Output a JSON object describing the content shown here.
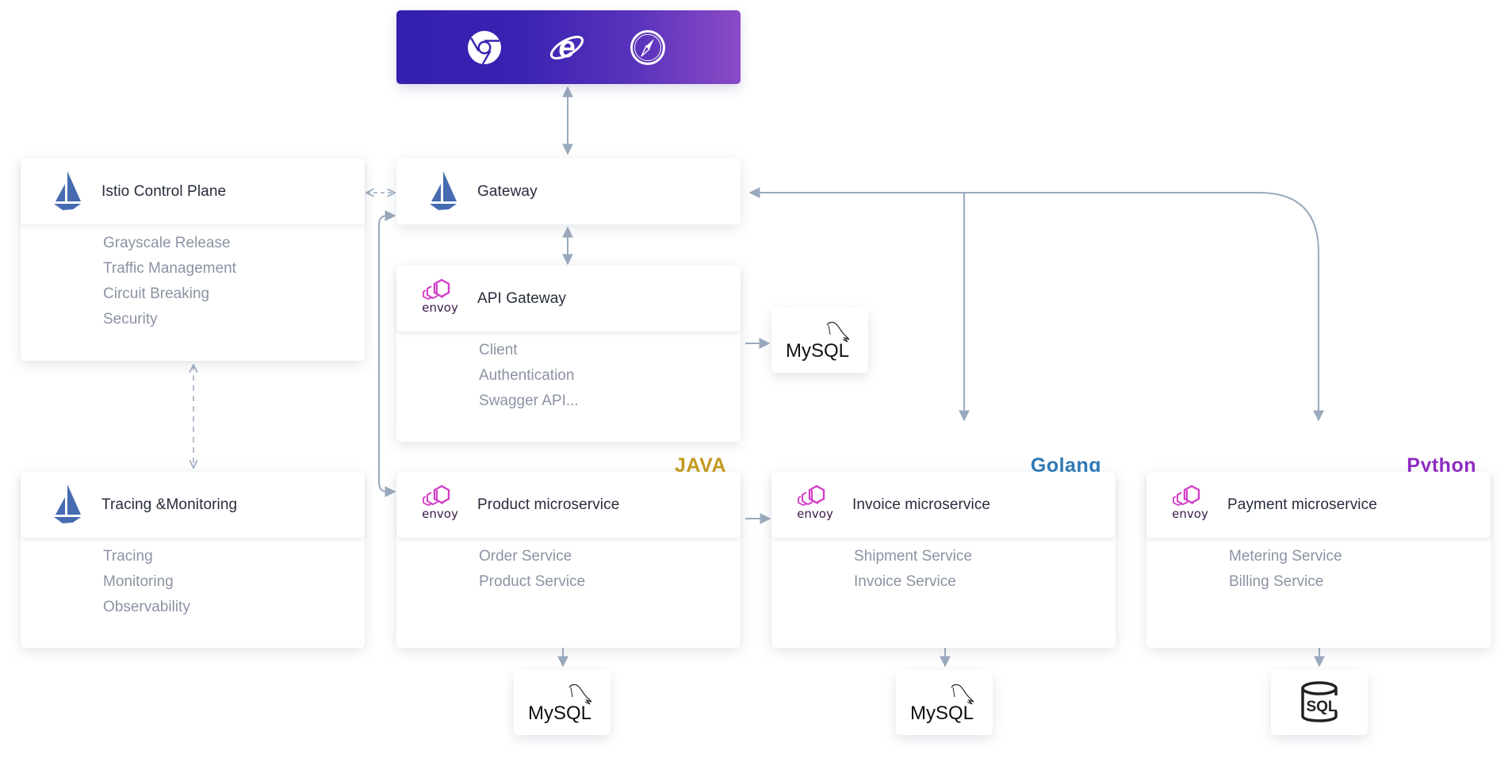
{
  "browsers": [
    {
      "name": "Chrome",
      "icon": "chrome-icon"
    },
    {
      "name": "Internet Explorer",
      "icon": "internet-explorer-icon"
    },
    {
      "name": "Safari",
      "icon": "safari-icon"
    }
  ],
  "cards": {
    "istio_control_plane": {
      "title": "Istio Control Plane",
      "icon": "istio-icon",
      "items": [
        "Grayscale Release",
        "Traffic Management",
        "Circuit Breaking",
        "Security"
      ]
    },
    "gateway": {
      "title": "Gateway",
      "icon": "istio-icon"
    },
    "api_gateway": {
      "title": "API Gateway",
      "icon": "envoy-icon",
      "items": [
        "Client",
        "Authentication",
        "Swagger API..."
      ]
    },
    "tracing_monitoring": {
      "title": "Tracing &Monitoring",
      "icon": "istio-icon",
      "items": [
        "Tracing",
        "Monitoring",
        "Observability"
      ]
    },
    "product": {
      "title": "Product microservice",
      "icon": "envoy-icon",
      "language": "JAVA",
      "items": [
        "Order Service",
        "Product Service"
      ]
    },
    "invoice": {
      "title": "Invoice microservice",
      "icon": "envoy-icon",
      "language": "Golang",
      "items": [
        "Shipment Service",
        "Invoice Service"
      ]
    },
    "payment": {
      "title": "Payment microservice",
      "icon": "envoy-icon",
      "language": "Python",
      "items": [
        "Metering Service",
        "Billing Service"
      ]
    }
  },
  "databases": {
    "api_gateway_db": {
      "label": "MySQL",
      "icon": "mysql-icon"
    },
    "product_db": {
      "label": "MySQL",
      "icon": "mysql-icon"
    },
    "invoice_db": {
      "label": "MySQL",
      "icon": "mysql-icon"
    },
    "payment_db": {
      "label": "SQL",
      "icon": "sql-database-icon"
    }
  },
  "envoy_wordmark": "envoy",
  "colors": {
    "istio_blue": "#466bb0",
    "envoy_magenta": "#d33fc7",
    "envoy_text": "#3a1a4a",
    "java": "#c49a1f",
    "golang": "#2e79b6",
    "python": "#8e2cc2",
    "connector": "#9aaabd",
    "title_text": "#272d3b",
    "item_text": "#8b93a3",
    "browser_gradient_start": "#3320ae",
    "browser_gradient_end": "#8a4bc6"
  }
}
